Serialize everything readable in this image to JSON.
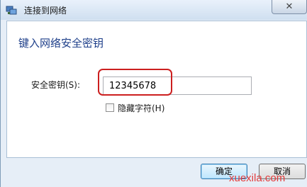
{
  "window": {
    "title": "连接到网络",
    "close_label": "✕"
  },
  "dialog": {
    "heading": "键入网络安全密钥",
    "key_label": "安全密钥(S):",
    "key_value": "12345678",
    "hide_chars_label": "隐藏字符(H)",
    "hide_chars_checked": false
  },
  "buttons": {
    "ok_label": "确定",
    "cancel_label": "取消"
  },
  "watermark": {
    "text": "xuexila.com"
  }
}
